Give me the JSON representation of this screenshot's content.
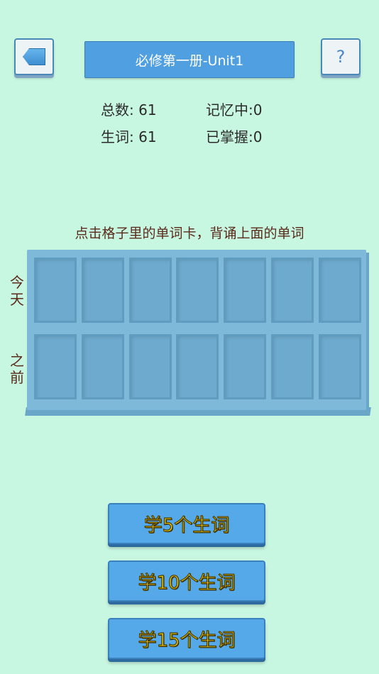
{
  "header": {
    "title": "必修第一册-Unit1",
    "back_icon": "back-arrow-icon",
    "help_label": "?"
  },
  "stats": {
    "total": "总数: 61",
    "memorizing": "记忆中:0",
    "new_words": "生词: 61",
    "mastered": "已掌握:0"
  },
  "instruction": "点击格子里的单词卡，背诵上面的单词",
  "rows": {
    "today": "今天",
    "before": "之前"
  },
  "grid": {
    "columns": 7,
    "rows": 2
  },
  "actions": [
    {
      "label": "学5个生词"
    },
    {
      "label": "学10个生词"
    },
    {
      "label": "学15个生词"
    }
  ],
  "colors": {
    "background": "#c8f7e1",
    "accent": "#4f9fe1",
    "button_text": "#f4d400"
  }
}
